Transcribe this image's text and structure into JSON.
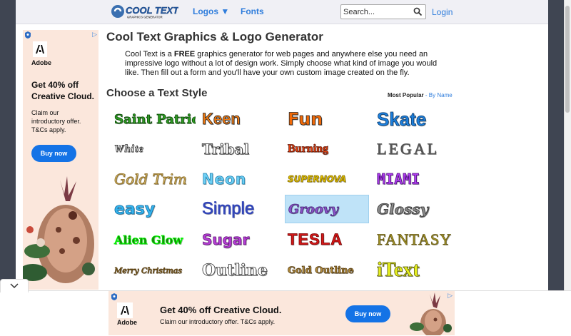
{
  "header": {
    "logo_main": "COOL TEXT",
    "logo_sub": "GRAPHICS GENERATOR",
    "nav": {
      "logos": "Logos ▼",
      "fonts": "Fonts"
    },
    "search": {
      "placeholder": "Search...",
      "value": ""
    },
    "login": "Login"
  },
  "main": {
    "title": "Cool Text Graphics & Logo Generator",
    "intro": {
      "before": "Cool Text is a ",
      "bold": "FREE",
      "after": " graphics generator for web pages and anywhere else you need an impressive logo without a lot of design work. Simply choose what kind of image you would like. Then fill out a form and you'll have your own custom image created on the fly."
    },
    "section_title": "Choose a Text Style",
    "sort": {
      "most_popular": "Most Popular",
      "sep": " - ",
      "by_name": "By Name"
    }
  },
  "styles": [
    {
      "label": "Saint Patrick",
      "color": "#2e9b22"
    },
    {
      "label": "Keen",
      "color": "#f07a12"
    },
    {
      "label": "Fun",
      "color": "#f26a08"
    },
    {
      "label": "Skate",
      "color": "#1d7fdc"
    },
    {
      "label": "White",
      "color": "#ffffff"
    },
    {
      "label": "Tribal",
      "color": "#ffffff"
    },
    {
      "label": "Burning",
      "color": "#e8410e"
    },
    {
      "label": "LEGAL",
      "color": "#555555"
    },
    {
      "label": "Gold Trim",
      "color": "#d7b96b"
    },
    {
      "label": "Neon",
      "color": "#6fd0f5"
    },
    {
      "label": "SUPERNOVA",
      "color": "#e6c500"
    },
    {
      "label": "MIAMI",
      "color": "#b13df0"
    },
    {
      "label": "easy",
      "color": "#36b3ec"
    },
    {
      "label": "Simple",
      "color": "#3346b8"
    },
    {
      "label": "Groovy",
      "color": "#8a52c7"
    },
    {
      "label": "Glossy",
      "color": "#8a8a8a"
    },
    {
      "label": "Alien Glow",
      "color": "#1c7b0d"
    },
    {
      "label": "Sugar",
      "color": "#b53ed4"
    },
    {
      "label": "TESLA",
      "color": "#d61818"
    },
    {
      "label": "FANTASY",
      "color": "#a7972a"
    },
    {
      "label": "Merry Christmas",
      "color": "#9c7b2e"
    },
    {
      "label": "Outline",
      "color": "#ffffff"
    },
    {
      "label": "Gold Outline",
      "color": "#b58e3e"
    },
    {
      "label": "iText",
      "color": "#e6ef20"
    }
  ],
  "selected_style": "Groovy",
  "side_ad": {
    "brand": "Adobe",
    "headline": "Get 40% off Creative Cloud.",
    "sub": "Claim our introductory offer. T&Cs apply.",
    "button": "Buy now"
  },
  "bottom_ad": {
    "brand": "Adobe",
    "headline": "Get 40% off Creative Cloud.",
    "sub": "Claim our introductory offer. T&Cs apply.",
    "button": "Buy now"
  },
  "colors": {
    "link": "#2f7ddc",
    "adobe_blue": "#1473e6",
    "ad_bg": "#fbe7dc"
  },
  "icons": [
    "search-icon",
    "adchoices-icon",
    "close-icon",
    "chevron-down-icon",
    "adobe-logo-icon"
  ]
}
